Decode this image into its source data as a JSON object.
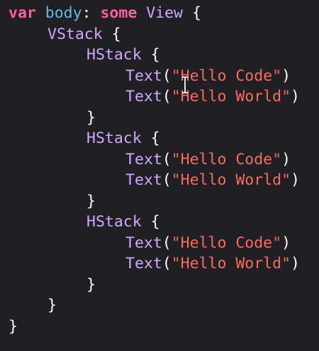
{
  "code": {
    "line1": {
      "kw_var": "var",
      "name": "body",
      "colon": ":",
      "kw_some": "some",
      "type": "View",
      "brace": "{"
    },
    "line2": {
      "type": "VStack",
      "brace": "{"
    },
    "stack1": {
      "open": {
        "type": "HStack",
        "brace": "{"
      },
      "text1": {
        "fn": "Text",
        "lp": "(",
        "str": "\"Hello Code\"",
        "rp": ")"
      },
      "text2": {
        "fn": "Text",
        "lp": "(",
        "str": "\"Hello World\"",
        "rp": ")"
      },
      "close": "}"
    },
    "stack2": {
      "open": {
        "type": "HStack",
        "brace": "{"
      },
      "text1": {
        "fn": "Text",
        "lp": "(",
        "str": "\"Hello Code\"",
        "rp": ")"
      },
      "text2": {
        "fn": "Text",
        "lp": "(",
        "str": "\"Hello World\"",
        "rp": ")"
      },
      "close": "}"
    },
    "stack3": {
      "open": {
        "type": "HStack",
        "brace": "{"
      },
      "text1": {
        "fn": "Text",
        "lp": "(",
        "str": "\"Hello Code\"",
        "rp": ")"
      },
      "text2": {
        "fn": "Text",
        "lp": "(",
        "str": "\"Hello World\"",
        "rp": ")"
      },
      "close": "}"
    },
    "vstack_close": "}",
    "body_close": "}"
  },
  "colors": {
    "background": "#1f1f24",
    "keyword": "#fc5fa3",
    "declaration": "#67b7e9",
    "type": "#d0a8ff",
    "string": "#fc6a5d",
    "plain": "#ffffff"
  },
  "icons": {
    "cursor": "text-cursor-icon"
  }
}
